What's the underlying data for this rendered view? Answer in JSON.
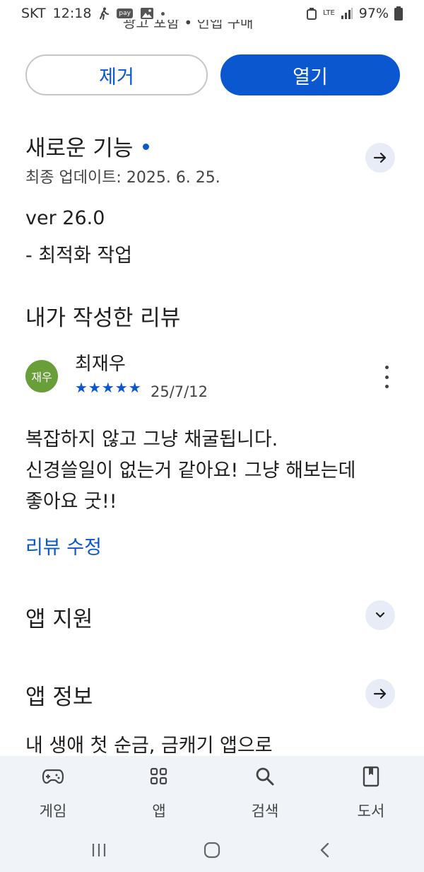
{
  "status_bar": {
    "carrier": "SKT",
    "time": "12:18",
    "pay_label": "pay",
    "network": "LTE",
    "battery": "97%"
  },
  "cut_text": "광고 포함 • 인앱 구매",
  "actions": {
    "remove_label": "제거",
    "open_label": "열기"
  },
  "whats_new": {
    "title": "새로운 기능",
    "last_updated": "최종 업데이트: 2025. 6. 25.",
    "version": "ver 26.0",
    "notes": "- 최적화 작업"
  },
  "my_review": {
    "section_title": "내가 작성한 리뷰",
    "avatar_text": "재우",
    "reviewer": "최재우",
    "rating": 5,
    "stars": "★★★★★",
    "date": "25/7/12",
    "lines": [
      "복잡하지 않고 그냥 채굴됩니다.",
      "신경쓸일이 없는거 같아요! 그냥 해보는데",
      "좋아요 굿!!"
    ],
    "edit_label": "리뷰 수정"
  },
  "app_support": {
    "title": "앱 지원"
  },
  "app_info": {
    "title": "앱 정보",
    "description": "내 생애 첫 순금, 금캐기 앱으로"
  },
  "bottom_nav": [
    {
      "label": "게임",
      "icon": "gamepad-icon"
    },
    {
      "label": "앱",
      "icon": "apps-grid-icon"
    },
    {
      "label": "검색",
      "icon": "search-icon"
    },
    {
      "label": "도서",
      "icon": "book-icon"
    }
  ],
  "colors": {
    "accent": "#0b57d0",
    "avatar_bg": "#689f38",
    "nav_bg": "#f0f4f9"
  }
}
